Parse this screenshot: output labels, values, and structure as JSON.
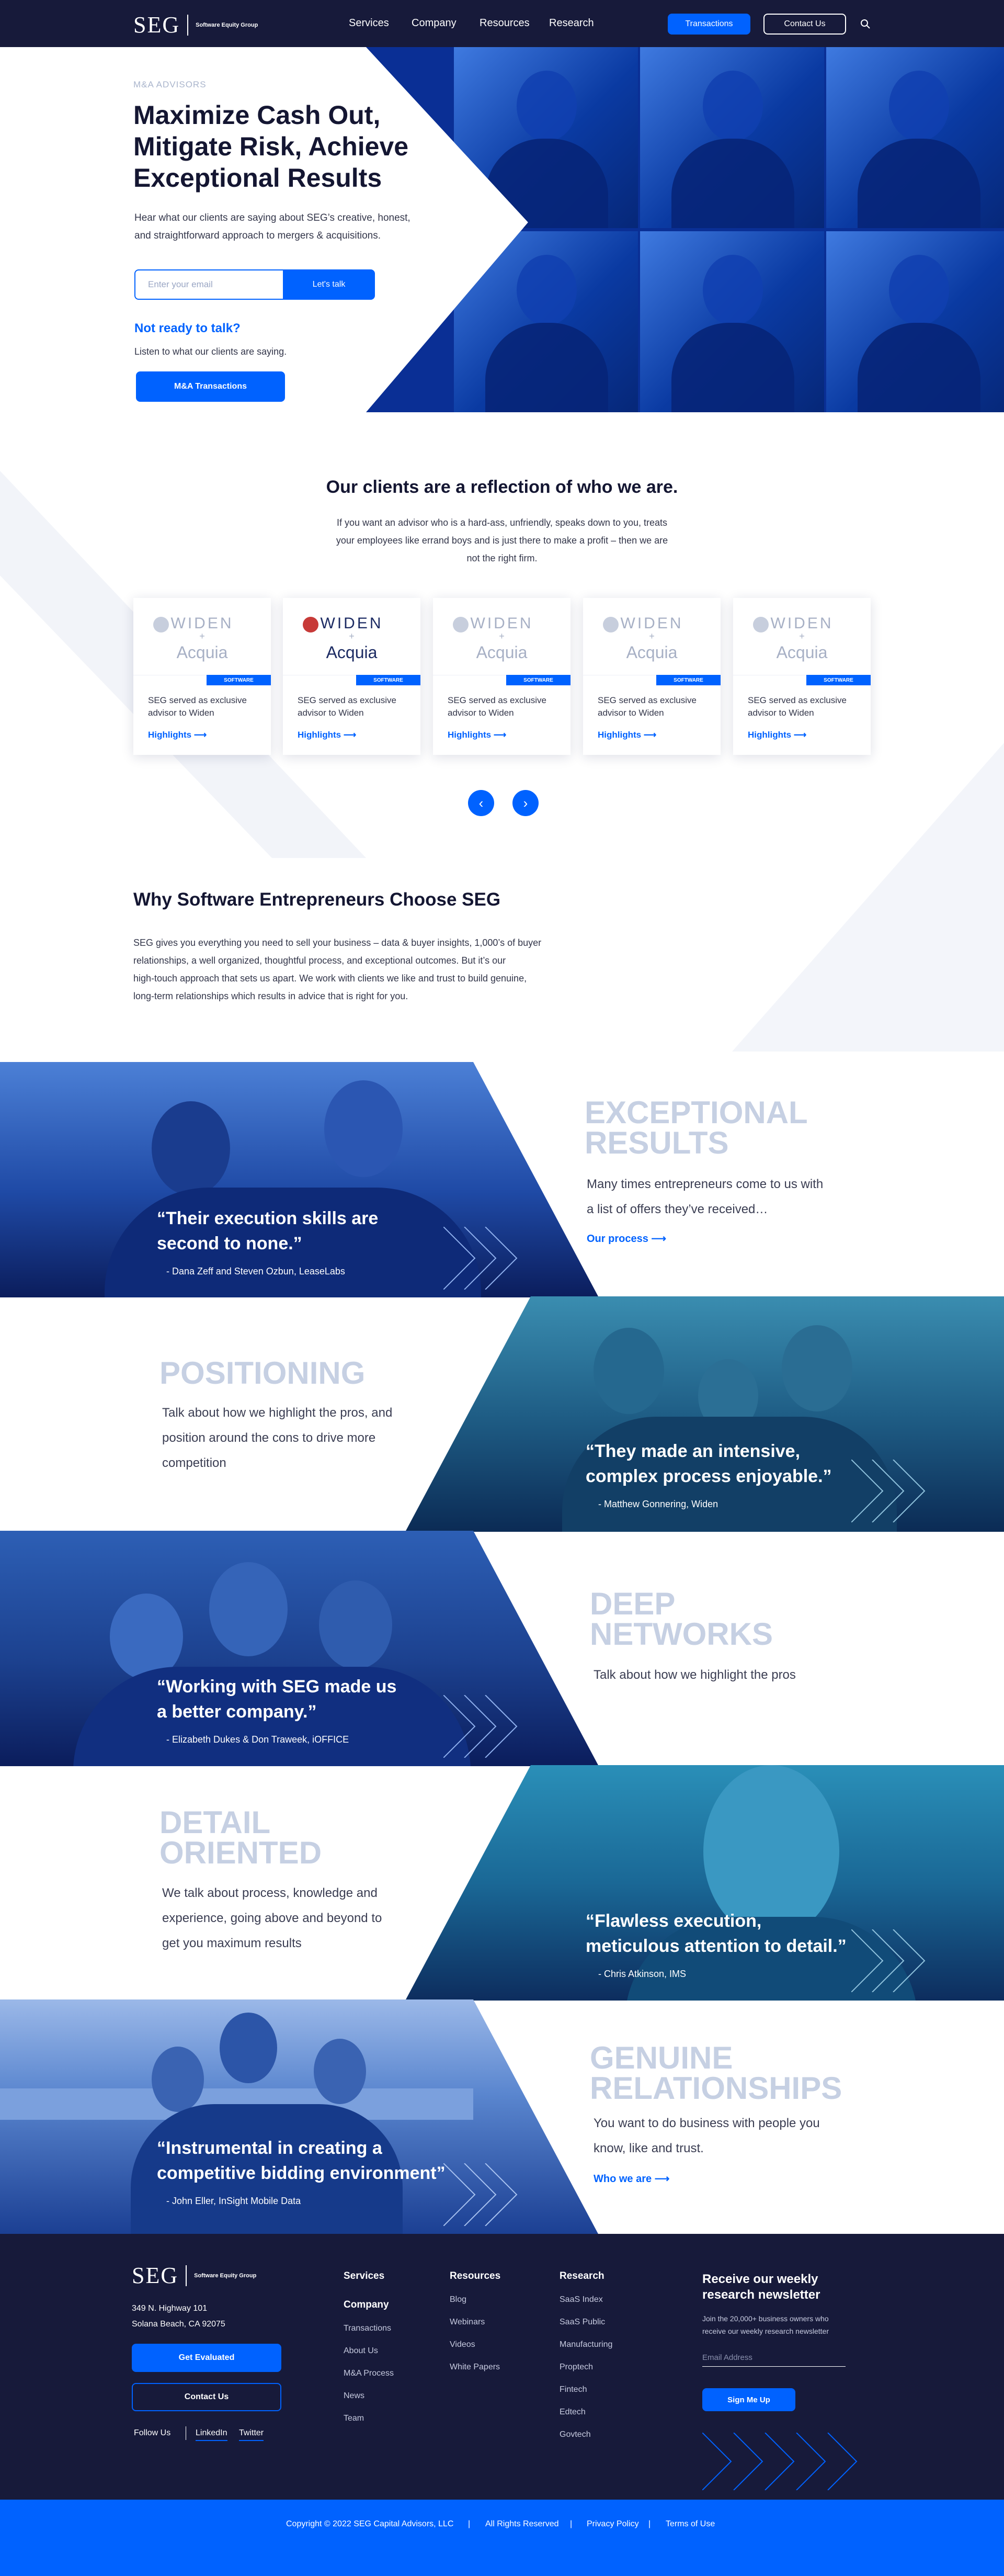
{
  "colors": {
    "navy": "#171a3a",
    "blue": "#0062ff",
    "pale": "#c6d0e3"
  },
  "nav": {
    "logo": "SEG",
    "logo_sub": "Software Equity Group",
    "links": [
      "Services",
      "Company",
      "Resources",
      "Research"
    ],
    "transactions": "Transactions",
    "contact": "Contact Us",
    "search_icon": "search-icon"
  },
  "hero": {
    "eyebrow": "M&A ADVISORS",
    "title": "Maximize Cash Out,\nMitigate Risk, Achieve\nExceptional Results",
    "body": "Hear what our clients are saying about SEG’s creative, honest,\nand straightforward approach to mergers & acquisitions.",
    "email_placeholder": "Enter your email",
    "cta": "Let's talk",
    "not_ready": "Not ready to talk?",
    "listen": "Listen to what our clients are saying.",
    "ma_button": "M&A Transactions"
  },
  "clients": {
    "title": "Our clients are a reflection of who we are.",
    "body": "If you want an advisor who is a hard-ass, unfriendly, speaks down to you, treats\nyour employees like errand boys and is just there to make a profit – then we are\nnot the right firm.",
    "cards": [
      {
        "w1": "WIDEN",
        "w2": "+",
        "w3": "Acquia",
        "tag": "SOFTWARE",
        "desc": "SEG served as exclusive\nadvisor to Widen",
        "link": "Highlights"
      },
      {
        "w1": "WIDEN",
        "w2": "+",
        "w3": "Acquia",
        "tag": "SOFTWARE",
        "desc": "SEG served as exclusive\nadvisor to Widen",
        "link": "Highlights"
      },
      {
        "w1": "WIDEN",
        "w2": "+",
        "w3": "Acquia",
        "tag": "SOFTWARE",
        "desc": "SEG served as exclusive\nadvisor to Widen",
        "link": "Highlights"
      },
      {
        "w1": "WIDEN",
        "w2": "+",
        "w3": "Acquia",
        "tag": "SOFTWARE",
        "desc": "SEG served as exclusive\nadvisor to Widen",
        "link": "Highlights"
      },
      {
        "w1": "WIDEN",
        "w2": "+",
        "w3": "Acquia",
        "tag": "SOFTWARE",
        "desc": "SEG served as exclusive\nadvisor to Widen",
        "link": "Highlights"
      }
    ],
    "prev": "‹",
    "next": "›"
  },
  "why": {
    "title": "Why Software Entrepreneurs Choose SEG",
    "body": "SEG gives you everything you need to sell your business – data & buyer insights, 1,000’s of buyer\nrelationships,  a well organized, thoughtful process, and exceptional outcomes.  But it’s our\nhigh-touch approach that sets us apart.  We work with clients we like and trust to build genuine,\nlong-term relationships which results in advice that is right for you."
  },
  "sections": [
    {
      "word": "EXCEPTIONAL\nRESULTS",
      "text": "Many times entrepreneurs come to us with\na list of offers they’ve received…",
      "link": "Our process",
      "quote": "“Their execution skills are\n second to none.”",
      "attr": "- Dana Zeff and Steven Ozbun, LeaseLabs"
    },
    {
      "word": "POSITIONING",
      "text": "Talk about how we highlight the pros, and\nposition around the cons to drive more\ncompetition",
      "link": "",
      "quote": "“They made an intensive,\n complex process enjoyable.”",
      "attr": "- Matthew Gonnering, Widen"
    },
    {
      "word": "DEEP\nNETWORKS",
      "text": "Talk about how we highlight the pros",
      "link": "",
      "quote": "“Working with SEG made us\n a better company.”",
      "attr": "- Elizabeth Dukes & Don Traweek, iOFFICE"
    },
    {
      "word": "DETAIL\nORIENTED",
      "text": "We talk about process, knowledge and\nexperience, going above and beyond to\nget you maximum results",
      "link": "",
      "quote": "“Flawless execution,\n meticulous attention to detail.”",
      "attr": "- Chris Atkinson, IMS"
    },
    {
      "word": "GENUINE\nRELATIONSHIPS",
      "text": "You want to do business with people you\nknow, like and trust.",
      "link": "Who we are",
      "quote": "“Instrumental in creating a\n competitive bidding environment”",
      "attr": "- John Eller, InSight Mobile Data"
    }
  ],
  "footer": {
    "address": "349 N. Highway 101\nSolana Beach, CA 92075",
    "get_evaluated": "Get Evaluated",
    "contact": "Contact Us",
    "follow": "Follow Us",
    "linkedin": "LinkedIn",
    "twitter": "Twitter",
    "col1": {
      "h1": "Services",
      "h2": "Company",
      "items": [
        "Transactions",
        "About Us",
        "M&A Process",
        "News",
        "Team"
      ]
    },
    "col2": {
      "h": "Resources",
      "items": [
        "Blog",
        "Webinars",
        "Videos",
        "White Papers"
      ]
    },
    "col3": {
      "h": "Research",
      "items": [
        "SaaS Index",
        "SaaS Public",
        "Manufacturing",
        "Proptech",
        "Fintech",
        "Edtech",
        "Govtech"
      ]
    },
    "news": {
      "title": "Receive our weekly\nresearch newsletter",
      "text": "Join the 20,000+ business owners who\nreceive our weekly research newsletter",
      "placeholder": "Email Address",
      "button": "Sign Me Up"
    }
  },
  "bottom": {
    "copyright": "Copyright © 2022 SEG Capital Advisors, LLC",
    "rights": "All Rights Reserved",
    "privacy": "Privacy Policy",
    "terms": "Terms of Use",
    "sep": "|"
  }
}
